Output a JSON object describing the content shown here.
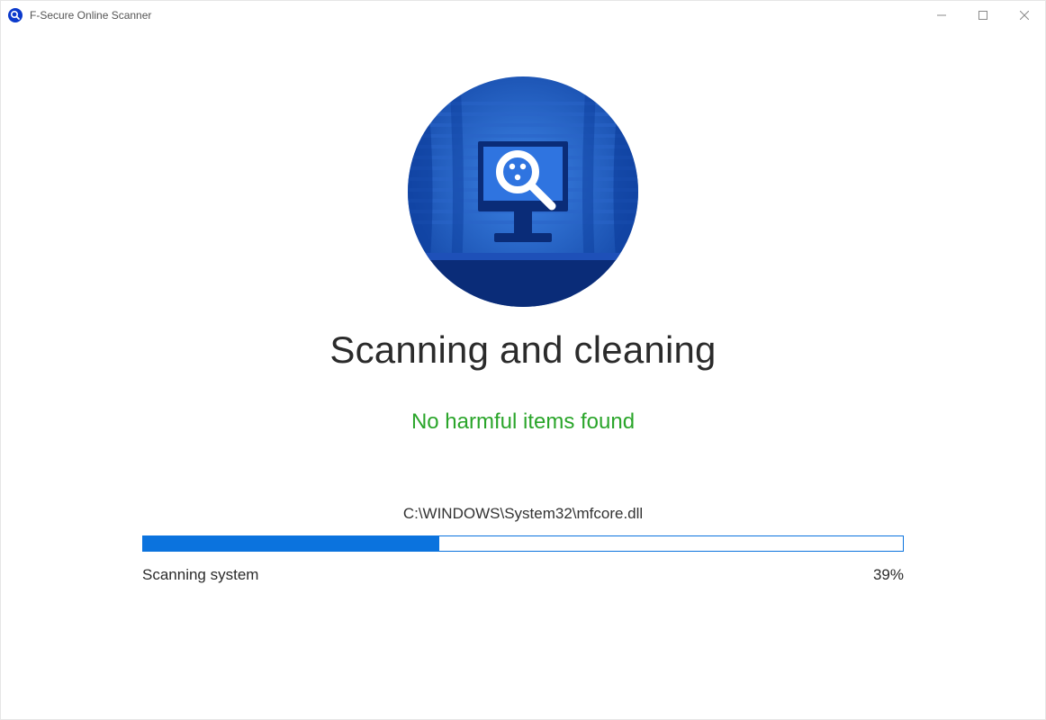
{
  "titlebar": {
    "title": "F-Secure Online Scanner"
  },
  "main": {
    "heading": "Scanning and cleaning",
    "status_message": "No harmful items found",
    "current_file": "C:\\WINDOWS\\System32\\mfcore.dll"
  },
  "progress": {
    "label": "Scanning system",
    "percent_value": 39,
    "percent_text": "39%"
  },
  "colors": {
    "accent": "#0b73de",
    "success": "#2aa52a"
  }
}
